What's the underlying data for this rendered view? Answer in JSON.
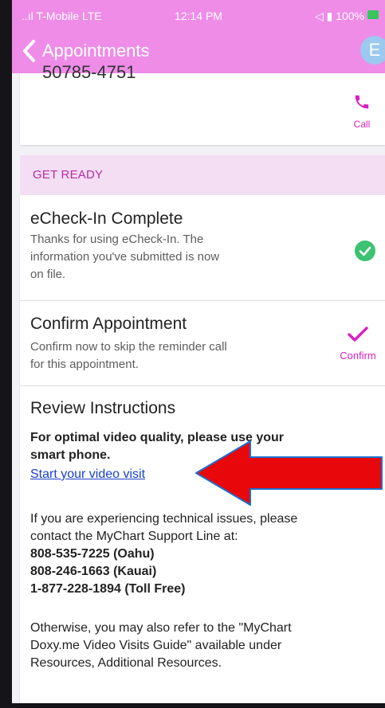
{
  "status_bar": {
    "left": "..ıl T-Mobile LTE",
    "time": "12:14 PM",
    "right": "◁ ▮ 100%"
  },
  "header": {
    "back_label": "Appointments",
    "avatar_initial": "E",
    "color": "#ee8ce8"
  },
  "contact_card": {
    "cut_text": "50785-4751",
    "call_label": "Call"
  },
  "section": {
    "label": "GET READY"
  },
  "echeckin": {
    "title": "eCheck-In Complete",
    "line1": "Thanks for using eCheck-In. The",
    "line2": "information you've submitted is now",
    "line3": "on file."
  },
  "confirm": {
    "title": "Confirm Appointment",
    "line1": "Confirm now to skip the reminder call",
    "line2": "for this appointment.",
    "button_label": "Confirm"
  },
  "instructions": {
    "title": "Review Instructions",
    "bold_line1": "For optimal video quality, please use your",
    "bold_line2": "smart phone.",
    "link_text": "Start your video visit",
    "support_line1": "If you are experiencing technical issues, please",
    "support_line2": "contact the MyChart Support Line at:",
    "phone_oahu": "808-535-7225 (Oahu)",
    "phone_kauai": "808-246-1663 (Kauai)",
    "phone_tollfree": "1-877-228-1894 (Toll Free)",
    "guide_line1": "Otherwise, you may also refer to the \"MyChart",
    "guide_line2": "Doxy.me Video Visits Guide\" available under",
    "guide_line3": "Resources, Additional Resources."
  },
  "colors": {
    "accent": "#d81fc1",
    "success": "#3cc270",
    "link": "#1a40cc",
    "arrow": "#e8070a"
  }
}
